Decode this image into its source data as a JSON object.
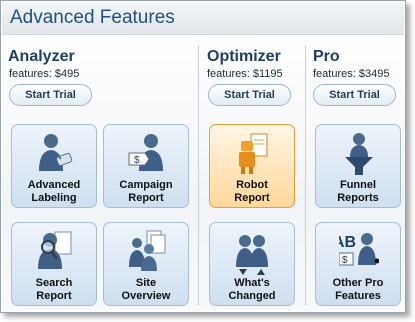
{
  "title": "Advanced Features",
  "trial_label": "Start Trial",
  "tiers": [
    {
      "name": "Analyzer",
      "price": "features: $495"
    },
    {
      "name": "Optimizer",
      "price": "features: $1195"
    },
    {
      "name": "Pro",
      "price": "features: $3495"
    }
  ],
  "tiles": {
    "advanced_labeling": [
      "Advanced",
      "Labeling"
    ],
    "campaign_report": [
      "Campaign",
      "Report"
    ],
    "search_report": [
      "Search",
      "Report"
    ],
    "site_overview": [
      "Site",
      "Overview"
    ],
    "robot_report": [
      "Robot",
      "Report"
    ],
    "whats_changed": [
      "What's",
      "Changed"
    ],
    "funnel_reports": [
      "Funnel",
      "Reports"
    ],
    "other_pro_features": [
      "Other Pro",
      "Features"
    ]
  },
  "icons": {
    "advanced_labeling": "person-with-tag-icon",
    "campaign_report": "person-with-dollar-icon",
    "search_report": "person-with-magnifier-icon",
    "site_overview": "group-with-documents-icon",
    "robot_report": "robot-with-document-icon",
    "whats_changed": "group-with-arrows-icon",
    "funnel_reports": "person-on-funnel-icon",
    "other_pro_features": "ab-test-person-icon"
  },
  "colors": {
    "title": "#1f4f8a",
    "tier": "#1f3f66",
    "tile_bg": "#cfdff0",
    "highlight_bg": "#ffd79a"
  }
}
